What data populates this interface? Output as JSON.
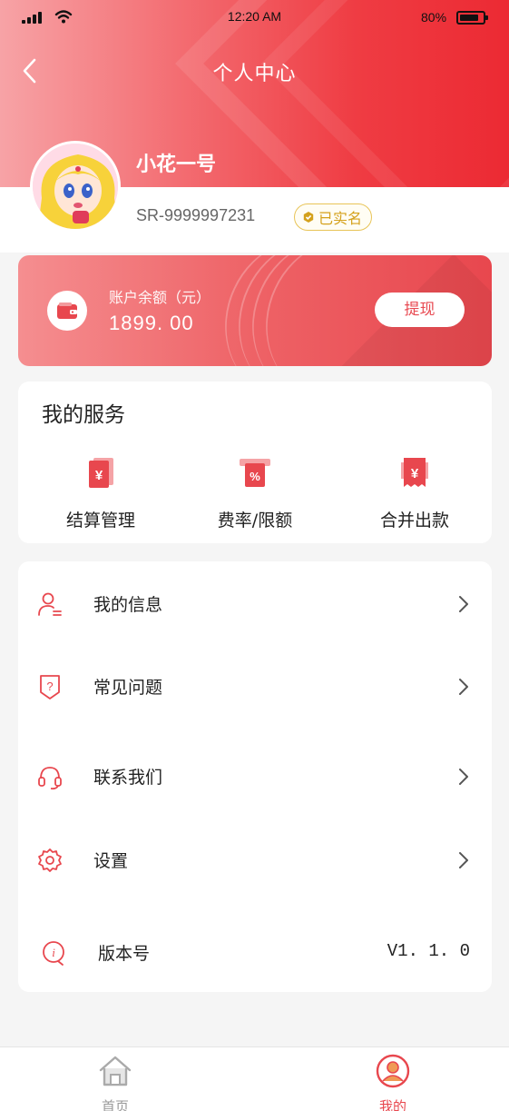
{
  "status_bar": {
    "time": "12:20 AM",
    "battery": "80%"
  },
  "nav": {
    "title": "个人中心"
  },
  "profile": {
    "name": "小花一号",
    "id": "SR-9999997231",
    "verified_label": "已实名"
  },
  "balance": {
    "label": "账户余额（元）",
    "value": "1899. 00",
    "withdraw_label": "提现"
  },
  "services": {
    "title": "我的服务",
    "items": [
      {
        "label": "结算管理",
        "icon": "yuan-doc-icon"
      },
      {
        "label": "费率/限额",
        "icon": "percent-icon"
      },
      {
        "label": "合并出款",
        "icon": "yuan-receipt-icon"
      }
    ]
  },
  "menu": {
    "items": [
      {
        "label": "我的信息",
        "icon": "user-info-icon"
      },
      {
        "label": "常见问题",
        "icon": "question-shield-icon"
      },
      {
        "label": "联系我们",
        "icon": "headset-icon"
      },
      {
        "label": "设置",
        "icon": "gear-icon"
      },
      {
        "label": "版本号",
        "icon": "info-icon",
        "value": "V1. 1. 0"
      }
    ]
  },
  "bottom_nav": {
    "items": [
      {
        "label": "首页",
        "icon": "home-icon",
        "active": false
      },
      {
        "label": "我的",
        "icon": "user-circle-icon",
        "active": true
      }
    ]
  },
  "colors": {
    "accent": "#e8474e",
    "gold": "#d4a11c",
    "inactive": "#999999"
  }
}
